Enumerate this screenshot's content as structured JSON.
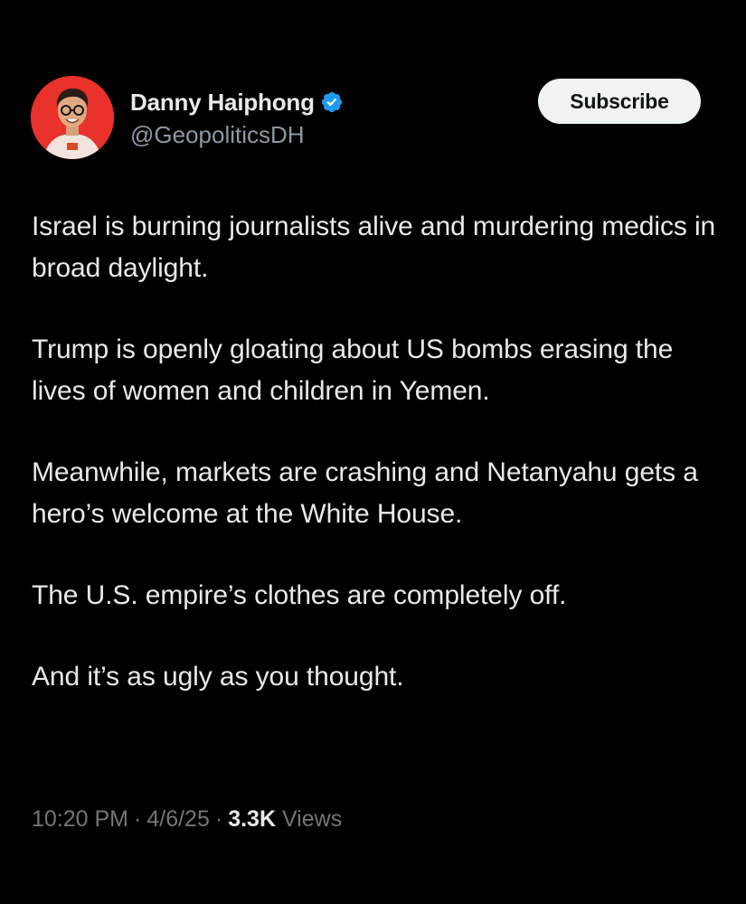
{
  "author": {
    "display_name": "Danny Haiphong",
    "handle": "@GeopoliticsDH",
    "verified_icon": "verified-badge-icon",
    "avatar": "avatar-photo"
  },
  "subscribe_label": "Subscribe",
  "body": [
    "Israel is burning journalists alive and murdering medics in broad daylight.",
    "Trump is openly gloating about US bombs erasing the lives of women and children in Yemen.",
    "Meanwhile, markets are crashing and Netanyahu gets a hero’s welcome at the White House.",
    "The U.S. empire’s clothes are completely off.",
    "And it’s as ugly as you thought."
  ],
  "meta": {
    "time": "10:20 PM",
    "separator": "·",
    "date": "4/6/25",
    "views_count": "3.3K",
    "views_label": "Views"
  },
  "colors": {
    "background": "#000000",
    "text": "#e7e9ea",
    "secondary_text": "#71767b",
    "verified_blue": "#1d9bf0",
    "button_bg": "#eff3f4"
  }
}
